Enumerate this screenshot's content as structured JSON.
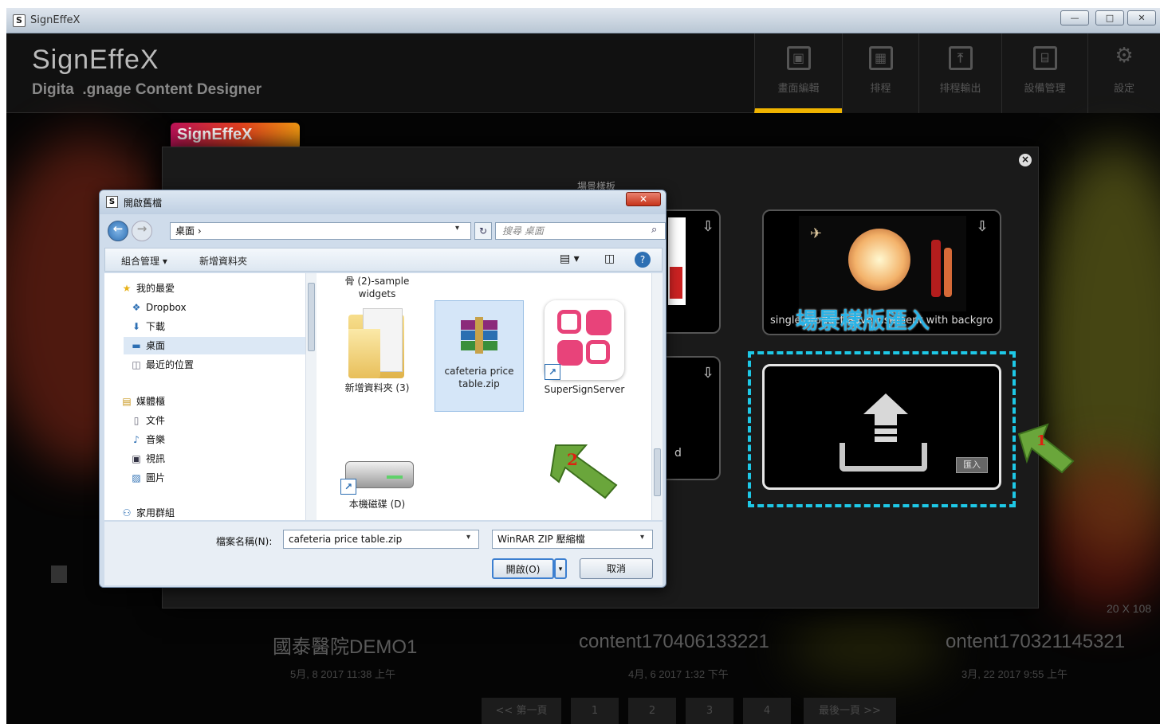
{
  "window": {
    "title": "SignEffeX",
    "min": "—",
    "max": "□",
    "close": "✕"
  },
  "app": {
    "brand": "SignEffeX",
    "subtitle": "Digita  .gnage Content Designer",
    "badge": "SignEffeX",
    "nav": [
      {
        "label": "畫面編輯",
        "icon": "image-icon",
        "glyph": "▣"
      },
      {
        "label": "排程",
        "icon": "calendar-icon",
        "glyph": "▦"
      },
      {
        "label": "排程輸出",
        "icon": "export-icon",
        "glyph": "⤒"
      },
      {
        "label": "設備管理",
        "icon": "device-icon",
        "glyph": "⌸"
      },
      {
        "label": "設定",
        "icon": "gear-icon",
        "glyph": "⚙"
      }
    ]
  },
  "modal": {
    "title": "場景樣板",
    "close": "×",
    "template_label": "single product advertisement with backgro...",
    "import_overlay": "場景樣版匯入",
    "import_button": "匯入",
    "side_letter": "d",
    "arrow1": "1",
    "arrow2": "2"
  },
  "dialog": {
    "title": "開啟舊檔",
    "close": "✕",
    "address": "桌面  ›",
    "search_placeholder": "搜尋 桌面",
    "toolbar": {
      "organize": "組合管理 ▾",
      "new_folder": "新增資料夾"
    },
    "nav_items": [
      {
        "label": "我的最愛",
        "glyph": "★",
        "indent": 0
      },
      {
        "label": "Dropbox",
        "glyph": "❖",
        "indent": 1
      },
      {
        "label": "下載",
        "glyph": "⬇",
        "indent": 1
      },
      {
        "label": "桌面",
        "glyph": "▬",
        "indent": 1
      },
      {
        "label": "最近的位置",
        "glyph": "◫",
        "indent": 1
      },
      {
        "label": "媒體櫃",
        "glyph": "▤",
        "indent": 0
      },
      {
        "label": "文件",
        "glyph": "▯",
        "indent": 1
      },
      {
        "label": "音樂",
        "glyph": "♪",
        "indent": 1
      },
      {
        "label": "視訊",
        "glyph": "▣",
        "indent": 1
      },
      {
        "label": "圖片",
        "glyph": "▨",
        "indent": 1
      },
      {
        "label": "家用群組",
        "glyph": "⚇",
        "indent": 0
      }
    ],
    "files": [
      {
        "label": "骨 (2)-sample widgets"
      },
      {
        "label": "新增資料夾 (3)"
      },
      {
        "label": "cafeteria price table.zip"
      },
      {
        "label": "SuperSignServer"
      },
      {
        "label": "本機磁碟 (D)"
      }
    ],
    "filename_label": "檔案名稱(N):",
    "filename_value": "cafeteria price table.zip",
    "filter_value": "WinRAR ZIP 壓縮檔",
    "open_button": "開啟(O)",
    "cancel_button": "取消"
  },
  "contents": [
    {
      "title": "國泰醫院DEMO1",
      "date": "5月, 8 2017 11:38 上午"
    },
    {
      "title": "content170406133221",
      "date": "4月, 6 2017 1:32 下午"
    },
    {
      "title": "ontent170321145321",
      "date": "3月, 22 2017 9:55 上午"
    }
  ],
  "resolution_hint": "20 X 108",
  "pagination": [
    "<< 第一頁",
    "1",
    "2",
    "3",
    "4",
    "最後一頁 >>"
  ],
  "colors": {
    "accent": "#f0b400",
    "highlight_dash": "#1ec8e6",
    "arrow_green": "#69a83a"
  }
}
